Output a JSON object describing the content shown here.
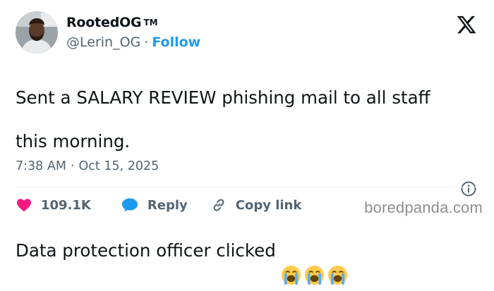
{
  "user": {
    "display_name": "RootedOG",
    "trademark": "TM",
    "handle": "@Lerin_OG",
    "separator": "·",
    "follow_label": "Follow"
  },
  "tweet": {
    "line1": "Sent a SALARY REVIEW phishing mail to all staff",
    "line2": "this morning.",
    "line3": "Data protection officer clicked",
    "emojis": [
      "loudly-crying-face",
      "loudly-crying-face",
      "loudly-crying-face"
    ]
  },
  "meta": {
    "time": "7:38 AM",
    "separator": "·",
    "date": "Oct 15, 2025"
  },
  "actions": {
    "like_count": "109.1K",
    "reply_label": "Reply",
    "copy_link_label": "Copy link"
  },
  "icons": {
    "x_logo": "x-logo-icon",
    "info": "info-icon",
    "like": "heart-icon",
    "reply": "speech-bubble-icon",
    "copy_link": "link-icon"
  },
  "colors": {
    "follow": "#1d9bf0",
    "like": "#f91880",
    "reply": "#1d9bf0",
    "secondary_text": "#536471"
  },
  "watermark": "boredpanda.com"
}
